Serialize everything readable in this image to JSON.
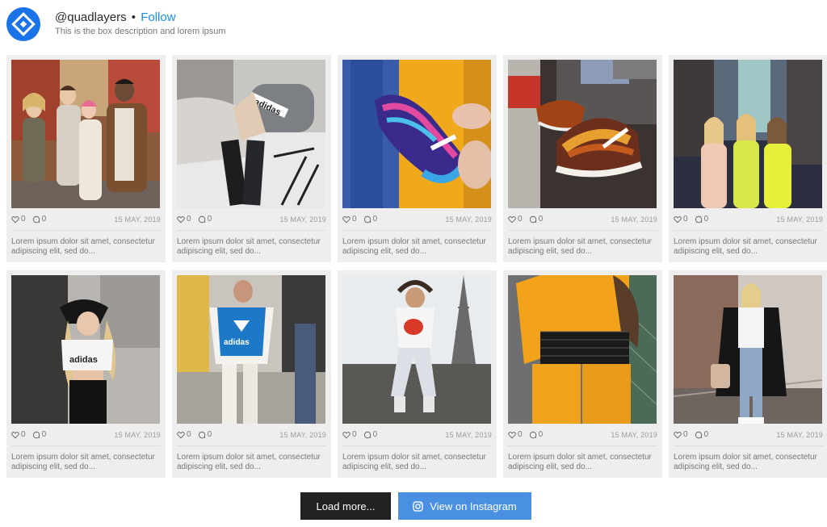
{
  "profile": {
    "username": "@quadlayers",
    "separator": "•",
    "follow_label": "Follow",
    "description": "This is the box description and lorem ipsum"
  },
  "posts": [
    {
      "likes": "0",
      "comments": "0",
      "date": "15 MAY, 2019",
      "caption": "Lorem ipsum dolor sit amet, consectetur adipiscing elit, sed do...",
      "scene": "friends-street"
    },
    {
      "likes": "0",
      "comments": "0",
      "date": "15 MAY, 2019",
      "caption": "Lorem ipsum dolor sit amet, consectetur adipiscing elit, sed do...",
      "scene": "adidas-sweater"
    },
    {
      "likes": "0",
      "comments": "0",
      "date": "15 MAY, 2019",
      "caption": "Lorem ipsum dolor sit amet, consectetur adipiscing elit, sed do...",
      "scene": "galaxy-sneaker"
    },
    {
      "likes": "0",
      "comments": "0",
      "date": "15 MAY, 2019",
      "caption": "Lorem ipsum dolor sit amet, consectetur adipiscing elit, sed do...",
      "scene": "nike-shoes"
    },
    {
      "likes": "0",
      "comments": "0",
      "date": "15 MAY, 2019",
      "caption": "Lorem ipsum dolor sit amet, consectetur adipiscing elit, sed do...",
      "scene": "three-girls"
    },
    {
      "likes": "0",
      "comments": "0",
      "date": "15 MAY, 2019",
      "caption": "Lorem ipsum dolor sit amet, consectetur adipiscing elit, sed do...",
      "scene": "crop-top-girl"
    },
    {
      "likes": "0",
      "comments": "0",
      "date": "15 MAY, 2019",
      "caption": "Lorem ipsum dolor sit amet, consectetur adipiscing elit, sed do...",
      "scene": "blue-hoodie"
    },
    {
      "likes": "0",
      "comments": "0",
      "date": "15 MAY, 2019",
      "caption": "Lorem ipsum dolor sit amet, consectetur adipiscing elit, sed do...",
      "scene": "eiffel-sitting"
    },
    {
      "likes": "0",
      "comments": "0",
      "date": "15 MAY, 2019",
      "caption": "Lorem ipsum dolor sit amet, consectetur adipiscing elit, sed do...",
      "scene": "orange-outfit"
    },
    {
      "likes": "0",
      "comments": "0",
      "date": "15 MAY, 2019",
      "caption": "Lorem ipsum dolor sit amet, consectetur adipiscing elit, sed do...",
      "scene": "black-coat"
    }
  ],
  "actions": {
    "load_more": "Load more...",
    "view_instagram": "View on Instagram"
  },
  "icons": {
    "logo": "quadlayers-logo-icon",
    "like": "heart-icon",
    "comment": "comment-icon",
    "instagram": "instagram-icon"
  },
  "colors": {
    "accent": "#1a8fe3",
    "logo_bg": "#1a73e8",
    "load_button": "#222222",
    "instagram_button": "#4a90e2",
    "card_bg": "#eeeeee"
  }
}
